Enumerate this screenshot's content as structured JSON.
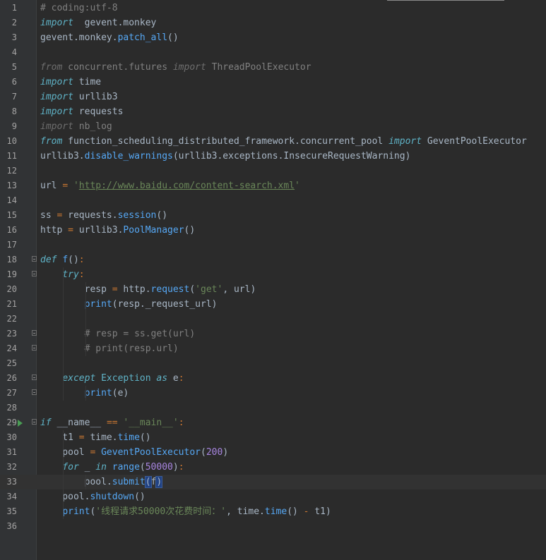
{
  "editor": {
    "language": "python",
    "current_line": 33,
    "lines": [
      {
        "n": "1",
        "parts": [
          [
            "com",
            "# coding:utf-8"
          ]
        ]
      },
      {
        "n": "2",
        "parts": [
          [
            "kwc",
            "import"
          ],
          [
            "p",
            "  gevent.monkey"
          ]
        ]
      },
      {
        "n": "3",
        "parts": [
          [
            "p",
            "gevent.monkey."
          ],
          [
            "fn",
            "patch_all"
          ],
          [
            "p",
            "()"
          ]
        ]
      },
      {
        "n": "4",
        "parts": []
      },
      {
        "n": "5",
        "parts": [
          [
            "gray",
            "from"
          ],
          [
            "g2",
            " concurrent.futures "
          ],
          [
            "gray",
            "import"
          ],
          [
            "g2",
            " ThreadPoolExecutor"
          ]
        ]
      },
      {
        "n": "6",
        "parts": [
          [
            "kwc",
            "import"
          ],
          [
            "p",
            " time"
          ]
        ]
      },
      {
        "n": "7",
        "parts": [
          [
            "kwc",
            "import"
          ],
          [
            "p",
            " urllib3"
          ]
        ]
      },
      {
        "n": "8",
        "parts": [
          [
            "kwc",
            "import"
          ],
          [
            "p",
            " requests"
          ]
        ]
      },
      {
        "n": "9",
        "parts": [
          [
            "gray",
            "import"
          ],
          [
            "g2",
            " nb_log"
          ]
        ]
      },
      {
        "n": "10",
        "parts": [
          [
            "kwc",
            "from"
          ],
          [
            "p",
            " function_scheduling_distributed_framework.concurrent_pool "
          ],
          [
            "kwc",
            "import"
          ],
          [
            "p",
            " GeventPoolExecutor"
          ]
        ]
      },
      {
        "n": "11",
        "parts": [
          [
            "p",
            "urllib3."
          ],
          [
            "fn",
            "disable_warnings"
          ],
          [
            "p",
            "(urllib3.exceptions.InsecureRequestWarning)"
          ]
        ]
      },
      {
        "n": "12",
        "parts": []
      },
      {
        "n": "13",
        "parts": [
          [
            "p",
            "url "
          ],
          [
            "op",
            "="
          ],
          [
            "p",
            " "
          ],
          [
            "dstr",
            "'"
          ],
          [
            "url",
            "http://www.baidu.com/content-search.xml"
          ],
          [
            "dstr",
            "'"
          ]
        ]
      },
      {
        "n": "14",
        "parts": []
      },
      {
        "n": "15",
        "parts": [
          [
            "p",
            "ss "
          ],
          [
            "op",
            "="
          ],
          [
            "p",
            " requests."
          ],
          [
            "fn",
            "session"
          ],
          [
            "p",
            "()"
          ]
        ]
      },
      {
        "n": "16",
        "parts": [
          [
            "p",
            "http "
          ],
          [
            "op",
            "="
          ],
          [
            "p",
            " urllib3."
          ],
          [
            "fn",
            "PoolManager"
          ],
          [
            "p",
            "()"
          ]
        ]
      },
      {
        "n": "17",
        "parts": []
      },
      {
        "n": "18",
        "parts": [
          [
            "kwc",
            "def"
          ],
          [
            "p",
            " "
          ],
          [
            "fn",
            "f"
          ],
          [
            "p",
            "()"
          ],
          [
            "op",
            ":"
          ]
        ],
        "fold": true
      },
      {
        "n": "19",
        "parts": [
          [
            "p",
            "    "
          ],
          [
            "kwc",
            "try"
          ],
          [
            "op",
            ":"
          ]
        ],
        "fold": true
      },
      {
        "n": "20",
        "parts": [
          [
            "p",
            "        resp "
          ],
          [
            "op",
            "="
          ],
          [
            "p",
            " http."
          ],
          [
            "fn",
            "request"
          ],
          [
            "p",
            "("
          ],
          [
            "dstr",
            "'get'"
          ],
          [
            "p",
            ", url)"
          ]
        ]
      },
      {
        "n": "21",
        "parts": [
          [
            "p",
            "        "
          ],
          [
            "fn",
            "print"
          ],
          [
            "p",
            "(resp._request_url)"
          ]
        ]
      },
      {
        "n": "22",
        "parts": []
      },
      {
        "n": "23",
        "parts": [
          [
            "p",
            "        "
          ],
          [
            "com",
            "# resp = ss.get(url)"
          ]
        ],
        "fold": true
      },
      {
        "n": "24",
        "parts": [
          [
            "p",
            "        "
          ],
          [
            "com",
            "# print(resp.url)"
          ]
        ],
        "fold": true
      },
      {
        "n": "25",
        "parts": []
      },
      {
        "n": "26",
        "parts": [
          [
            "p",
            "    "
          ],
          [
            "kwc",
            "except"
          ],
          [
            "p",
            " "
          ],
          [
            "cls",
            "Exception"
          ],
          [
            "p",
            " "
          ],
          [
            "kwc",
            "as"
          ],
          [
            "p",
            " e"
          ],
          [
            "op",
            ":"
          ]
        ],
        "fold": true
      },
      {
        "n": "27",
        "parts": [
          [
            "p",
            "        "
          ],
          [
            "fn",
            "print"
          ],
          [
            "p",
            "(e)"
          ]
        ],
        "fold": true
      },
      {
        "n": "28",
        "parts": []
      },
      {
        "n": "29",
        "parts": [
          [
            "kwc",
            "if"
          ],
          [
            "p",
            " __name__ "
          ],
          [
            "op",
            "=="
          ],
          [
            "p",
            " "
          ],
          [
            "dstr",
            "'__main__'"
          ],
          [
            "op",
            ":"
          ]
        ],
        "fold": true,
        "run": true
      },
      {
        "n": "30",
        "parts": [
          [
            "p",
            "    t1 "
          ],
          [
            "op",
            "="
          ],
          [
            "p",
            " time."
          ],
          [
            "fn",
            "time"
          ],
          [
            "p",
            "()"
          ]
        ]
      },
      {
        "n": "31",
        "parts": [
          [
            "p",
            "    pool "
          ],
          [
            "op",
            "="
          ],
          [
            "p",
            " "
          ],
          [
            "fn",
            "GeventPoolExecutor"
          ],
          [
            "p",
            "("
          ],
          [
            "num",
            "200"
          ],
          [
            "p",
            ")"
          ]
        ]
      },
      {
        "n": "32",
        "parts": [
          [
            "p",
            "    "
          ],
          [
            "kwc",
            "for"
          ],
          [
            "p",
            " _ "
          ],
          [
            "kwc",
            "in"
          ],
          [
            "p",
            " "
          ],
          [
            "fn",
            "range"
          ],
          [
            "p",
            "("
          ],
          [
            "num",
            "50000"
          ],
          [
            "p",
            ")"
          ],
          [
            "op",
            ":"
          ]
        ]
      },
      {
        "n": "33",
        "parts": [
          [
            "p",
            "        pool."
          ],
          [
            "fn",
            "submit"
          ],
          [
            "sel",
            "("
          ],
          [
            "p",
            "f"
          ],
          [
            "sel",
            ")"
          ]
        ]
      },
      {
        "n": "34",
        "parts": [
          [
            "p",
            "    pool."
          ],
          [
            "fn",
            "shutdown"
          ],
          [
            "p",
            "()"
          ]
        ]
      },
      {
        "n": "35",
        "parts": [
          [
            "p",
            "    "
          ],
          [
            "fn",
            "print"
          ],
          [
            "p",
            "("
          ],
          [
            "dstr",
            "'线程请求50000次花费时间：'"
          ],
          [
            "p",
            ", time."
          ],
          [
            "fn",
            "time"
          ],
          [
            "p",
            "() "
          ],
          [
            "op",
            "-"
          ],
          [
            "p",
            " t1)"
          ]
        ]
      },
      {
        "n": "36",
        "parts": []
      }
    ]
  },
  "colors": {
    "background": "#2b2b2b",
    "gutter": "#313335",
    "current_line": "#323232",
    "keyword": "#5fb3c7",
    "function": "#56a8f5",
    "string": "#ffc66d",
    "comment": "#808080",
    "number": "#a785e0",
    "operator": "#cc7832",
    "run_marker": "#499c54"
  }
}
